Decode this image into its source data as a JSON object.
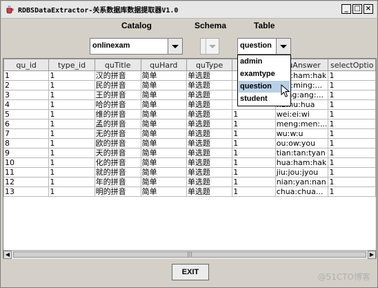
{
  "window": {
    "title": "RDBSDataExtractor-关系数据库数据提取器V1.0",
    "minimize": "_",
    "maximize": "□",
    "close": "×"
  },
  "labels": {
    "catalog": "Catalog",
    "schema": "Schema",
    "table": "Table"
  },
  "combos": {
    "catalog_value": "onlinexam",
    "schema_value": "",
    "table_value": "question"
  },
  "dropdown_options": [
    "admin",
    "examtype",
    "question",
    "student"
  ],
  "dropdown_selected_index": 2,
  "table": {
    "columns": [
      "qu_id",
      "type_id",
      "quTitle",
      "quHard",
      "quType",
      "",
      "quAnswer",
      "selectOptio"
    ],
    "rows": [
      [
        "1",
        "1",
        "汉的拼音",
        "简单",
        "单选题",
        "",
        "han:ham:hak",
        "1"
      ],
      [
        "2",
        "1",
        "民的拼音",
        "简单",
        "单选题",
        "",
        "min:ming:...",
        "1"
      ],
      [
        "3",
        "1",
        "王的拼音",
        "简单",
        "单选题",
        "",
        "wang:ang:...",
        "1"
      ],
      [
        "4",
        "1",
        "哈的拼音",
        "简单",
        "单选题",
        "",
        "ha:hu:hua",
        "1"
      ],
      [
        "5",
        "1",
        "维的拼音",
        "简单",
        "单选题",
        "1",
        "wei:ei:wi",
        "1"
      ],
      [
        "6",
        "1",
        "孟的拼音",
        "简单",
        "单选题",
        "1",
        "meng:men:...",
        "1"
      ],
      [
        "7",
        "1",
        "无的拼音",
        "简单",
        "单选题",
        "1",
        "wu:w:u",
        "1"
      ],
      [
        "8",
        "1",
        "欧的拼音",
        "简单",
        "单选题",
        "1",
        "ou:ow:you",
        "1"
      ],
      [
        "9",
        "1",
        "天的拼音",
        "简单",
        "单选题",
        "1",
        "tian:tan:tyan",
        "1"
      ],
      [
        "10",
        "1",
        "化的拼音",
        "简单",
        "单选题",
        "1",
        "hua:ham:hak",
        "1"
      ],
      [
        "11",
        "1",
        "就的拼音",
        "简单",
        "单选题",
        "1",
        "jiu:jou:jyou",
        "1"
      ],
      [
        "12",
        "1",
        "年的拼音",
        "简单",
        "单选题",
        "1",
        "nian:yan:nan",
        "1"
      ],
      [
        "13",
        "1",
        "明的拼音",
        "简单",
        "单选题",
        "1",
        "chua:chua...",
        "1"
      ]
    ]
  },
  "exit_label": "EXIT",
  "watermark": "@51CTO博客"
}
